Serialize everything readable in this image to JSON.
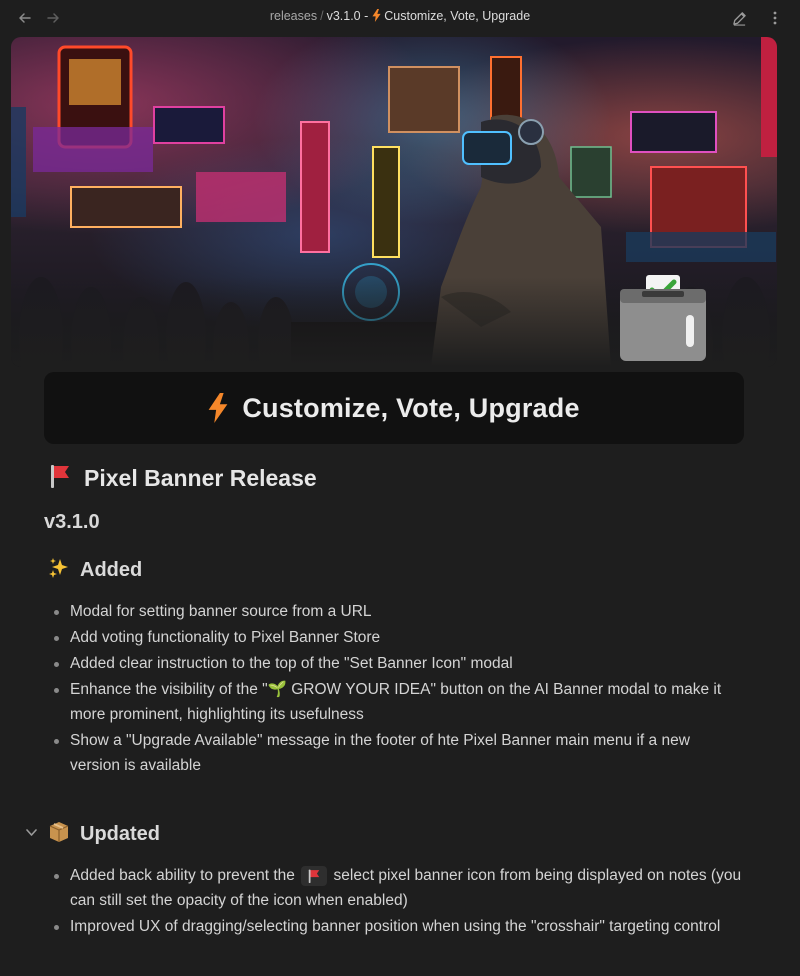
{
  "topbar": {
    "back_icon": "arrow-left-icon",
    "forward_icon": "arrow-right-icon",
    "breadcrumb": {
      "folder": "releases",
      "separator": "/",
      "version_prefix": "v3.1.0 -",
      "title": "Customize, Vote, Upgrade"
    },
    "edit_icon": "pencil-icon",
    "more_icon": "more-vertical-icon"
  },
  "banner": {
    "image_icon": "cyberpunk-banner-image",
    "badge_icon": "ballot-box-icon"
  },
  "title_card": {
    "icon": "lightning-bolt-icon",
    "title": "Customize, Vote, Upgrade"
  },
  "content": {
    "release_heading": {
      "icon": "red-flag-icon",
      "text": "Pixel Banner Release"
    },
    "version": "v3.1.0",
    "added": {
      "icon": "sparkles-icon",
      "heading": "Added",
      "items": [
        "Modal for setting banner source from a URL",
        "Add voting functionality to Pixel Banner Store",
        "Added clear instruction to the top of the \"Set Banner Icon\" modal",
        "Enhance the visibility of the \"🌱 GROW YOUR IDEA\" button on the AI Banner modal to make it more prominent, highlighting its usefulness",
        "Show a \"Upgrade Available\" message in the footer of hte Pixel Banner main menu if a new version is available"
      ]
    },
    "updated": {
      "collapse_icon": "chevron-down-icon",
      "icon": "package-icon",
      "heading": "Updated",
      "item1_before": "Added back ability to prevent the",
      "item1_after": "select pixel banner icon from being displayed on notes (you can still set the opacity of the icon when enabled)",
      "item2": "Improved UX of dragging/selecting banner position when using the \"crosshair\" targeting control"
    }
  },
  "colors": {
    "background": "#1e1e1e",
    "title_card": "#111111",
    "bolt": "#f5872a",
    "flag": "#e0353b",
    "text": "#dadada"
  }
}
